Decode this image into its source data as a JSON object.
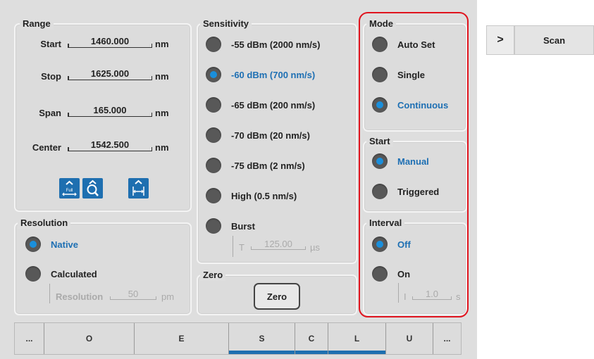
{
  "range": {
    "title": "Range",
    "start": {
      "label": "Start",
      "value": "1460.000",
      "unit": "nm"
    },
    "stop": {
      "label": "Stop",
      "value": "1625.000",
      "unit": "nm"
    },
    "span": {
      "label": "Span",
      "value": "165.000",
      "unit": "nm"
    },
    "center": {
      "label": "Center",
      "value": "1542.500",
      "unit": "nm"
    },
    "icons": {
      "full_text": "Full",
      "names": [
        "full-range-icon",
        "zoom-icon",
        "fit-span-icon"
      ]
    }
  },
  "sensitivity": {
    "title": "Sensitivity",
    "options": [
      {
        "label": "-55 dBm (2000 nm/s)",
        "selected": false
      },
      {
        "label": "-60 dBm (700 nm/s)",
        "selected": true
      },
      {
        "label": "-65 dBm (200 nm/s)",
        "selected": false
      },
      {
        "label": "-70 dBm (20 nm/s)",
        "selected": false
      },
      {
        "label": "-75 dBm (2 nm/s)",
        "selected": false
      },
      {
        "label": "High (0.5 nm/s)",
        "selected": false
      },
      {
        "label": "Burst",
        "selected": false
      }
    ],
    "burst_t": {
      "label": "T",
      "value": "125.00",
      "unit": "µs"
    }
  },
  "resolution": {
    "title": "Resolution",
    "native": "Native",
    "calculated": "Calculated",
    "field": {
      "label": "Resolution",
      "value": "50",
      "unit": "pm"
    }
  },
  "zero": {
    "title": "Zero",
    "button": "Zero"
  },
  "mode": {
    "title": "Mode",
    "options": [
      {
        "label": "Auto Set",
        "selected": false
      },
      {
        "label": "Single",
        "selected": false
      },
      {
        "label": "Continuous",
        "selected": true
      }
    ]
  },
  "start": {
    "title": "Start",
    "options": [
      {
        "label": "Manual",
        "selected": true
      },
      {
        "label": "Triggered",
        "selected": false
      }
    ]
  },
  "interval": {
    "title": "Interval",
    "options": [
      {
        "label": "Off",
        "selected": true
      },
      {
        "label": "On",
        "selected": false
      }
    ],
    "field": {
      "label": "I",
      "value": "1.0",
      "unit": "s"
    }
  },
  "bands": [
    "...",
    "O",
    "E",
    "S",
    "C",
    "L",
    "U",
    "..."
  ],
  "side": {
    "arrow": ">",
    "scan": "Scan"
  },
  "colors": {
    "accent": "#1e6fb0",
    "selected_text": "#1d6fb3",
    "highlight": "#e0141e"
  }
}
